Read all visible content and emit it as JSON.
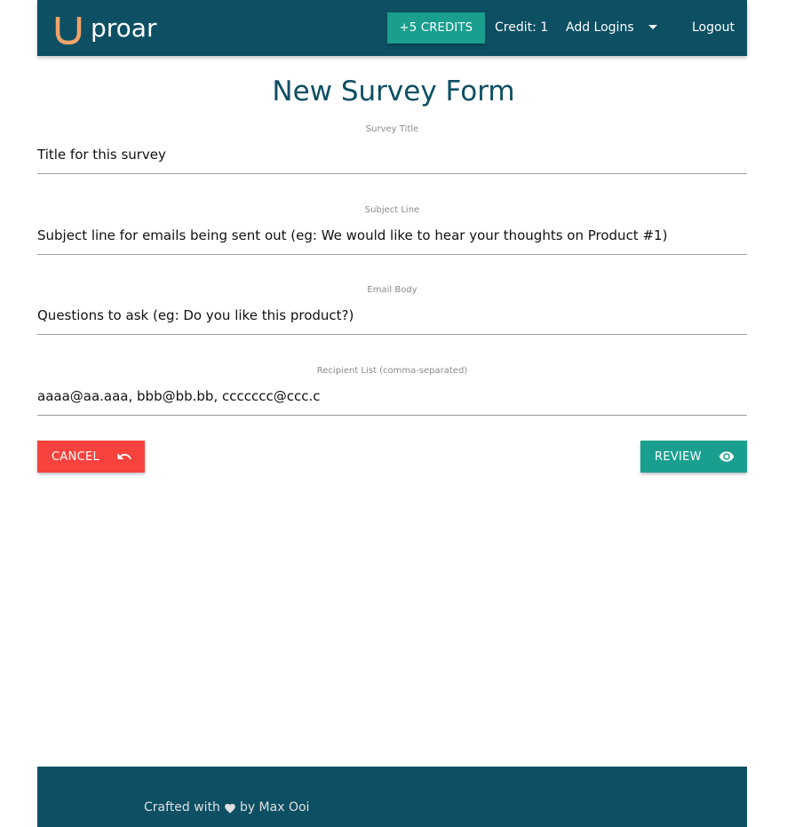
{
  "app": {
    "name": "proar"
  },
  "nav": {
    "credits_button": "+5 CREDITS",
    "credit_count": "Credit: 1",
    "add_logins": "Add Logins",
    "logout": "Logout"
  },
  "page": {
    "title": "New Survey Form"
  },
  "form": {
    "fields": [
      {
        "label": "Survey Title",
        "placeholder": "Title for this survey",
        "value": ""
      },
      {
        "label": "Subject Line",
        "placeholder": "Subject line for emails being sent out (eg: We would like to hear your thoughts on Product #1)",
        "value": ""
      },
      {
        "label": "Email Body",
        "placeholder": "Questions to ask (eg: Do you like this product?)",
        "value": ""
      },
      {
        "label": "Recipient List (comma-separated)",
        "placeholder": "",
        "value": "aaaa@aa.aaa, bbb@bb.bb, ccccccc@ccc.c"
      }
    ],
    "cancel_label": "CANCEL",
    "cancel_icon": "undo-icon",
    "review_label": "REVIEW",
    "review_icon": "eye-icon"
  },
  "footer": {
    "prefix": "Crafted with",
    "suffix": "by Max Ooi",
    "icon": "heart-icon"
  },
  "colors": {
    "primary": "#0d4f63",
    "accent": "#1a9f8f",
    "danger": "#f7423d",
    "logo": "#f0a36b"
  }
}
